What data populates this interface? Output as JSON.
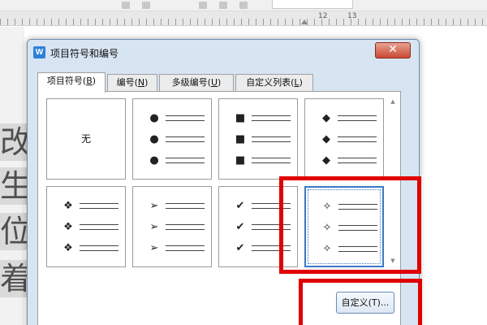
{
  "ruler": {
    "numbers": [
      "12",
      "13"
    ]
  },
  "document": {
    "chars": [
      "改",
      "生",
      "位",
      "着"
    ]
  },
  "dialog": {
    "title": "项目符号和编号",
    "app_icon": "W",
    "close_label": "✕",
    "tabs": [
      {
        "label_main": "项目符号(",
        "label_key": "B",
        "label_end": ")"
      },
      {
        "label_main": "编号(",
        "label_key": "N",
        "label_end": ")"
      },
      {
        "label_main": "多级编号(",
        "label_key": "U",
        "label_end": ")"
      },
      {
        "label_main": "自定义列表(",
        "label_key": "L",
        "label_end": ")"
      }
    ],
    "bullets": {
      "none_label": "无",
      "symbols": [
        "●",
        "■",
        "◆",
        "❖",
        "➢",
        "✔",
        "✧"
      ],
      "selected": "✧"
    },
    "custom_button": {
      "label": "自定义(T)..."
    }
  },
  "colors": {
    "highlight": "#e00000",
    "selection": "#3b78c4",
    "dialog_frame": "#d7e4f2"
  },
  "icons": [
    "wps-writer-icon",
    "close-icon",
    "scroll-up-arrow-icon",
    "scroll-down-arrow-icon"
  ]
}
